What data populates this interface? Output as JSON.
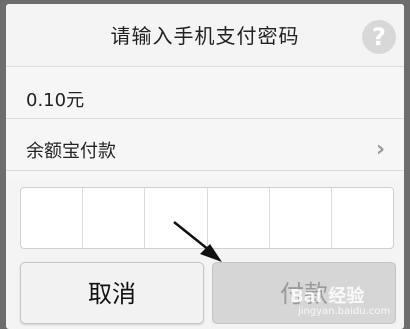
{
  "dialog": {
    "title": "请输入手机支付密码",
    "help_icon": "question-mark-icon",
    "amount": "0.10元",
    "payment_method": "余额宝付款",
    "chevron_icon": "chevron-right-icon",
    "pin_cells": 6,
    "cancel_label": "取消",
    "pay_label": "付款"
  },
  "watermark": {
    "logo": "Bai 经验",
    "url": "jingyan.baidu.com"
  },
  "colors": {
    "overlay": "#6d6d6d",
    "dialog_bg": "#f4f4f4",
    "pay_disabled": "#d6d6d6"
  }
}
